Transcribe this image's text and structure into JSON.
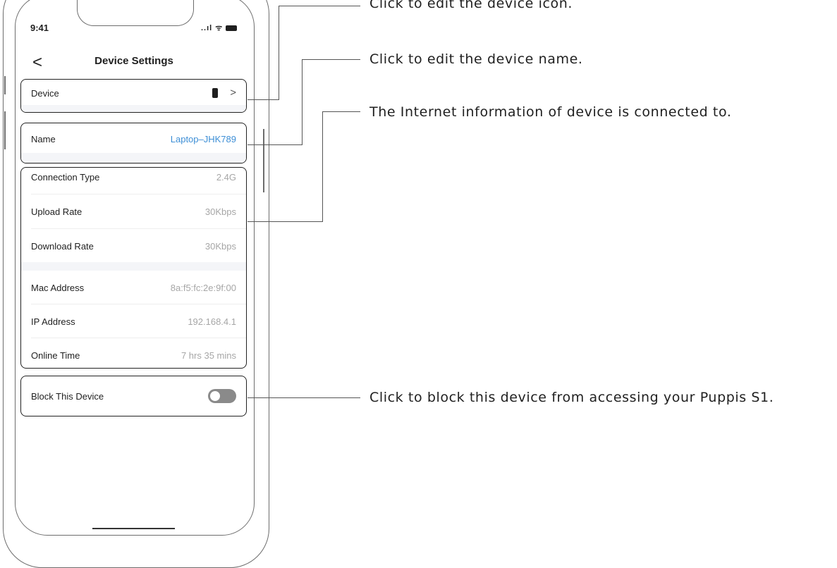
{
  "status_bar": {
    "time": "9:41",
    "signal": "..ıl",
    "wifi": "ᯤ"
  },
  "nav": {
    "back": "<",
    "title": "Device Settings"
  },
  "device_card": {
    "label": "Device",
    "chevron": ">"
  },
  "name_card": {
    "label": "Name",
    "value": "Laptop–JHK789"
  },
  "network_card": {
    "rows": [
      {
        "label": "Connection Type",
        "value": "2.4G"
      },
      {
        "label": "Upload Rate",
        "value": "30Kbps"
      },
      {
        "label": "Download Rate",
        "value": "30Kbps"
      },
      {
        "label": "Mac Address",
        "value": "8a:f5:fc:2e:9f:00"
      },
      {
        "label": "IP Address",
        "value": "192.168.4.1"
      },
      {
        "label": "Online Time",
        "value": "7 hrs 35 mins"
      }
    ]
  },
  "block_card": {
    "label": "Block This Device",
    "toggle_on": false
  },
  "callouts": {
    "icon": "Click to edit the device icon.",
    "name": "Click to edit the device name.",
    "internet": "The Internet information of device is connected to.",
    "block": "Click to block this device from accessing your Puppis S1."
  },
  "colors": {
    "link": "#3e8fd6",
    "muted": "#a6a6a6",
    "band": "#f4f5f8"
  }
}
